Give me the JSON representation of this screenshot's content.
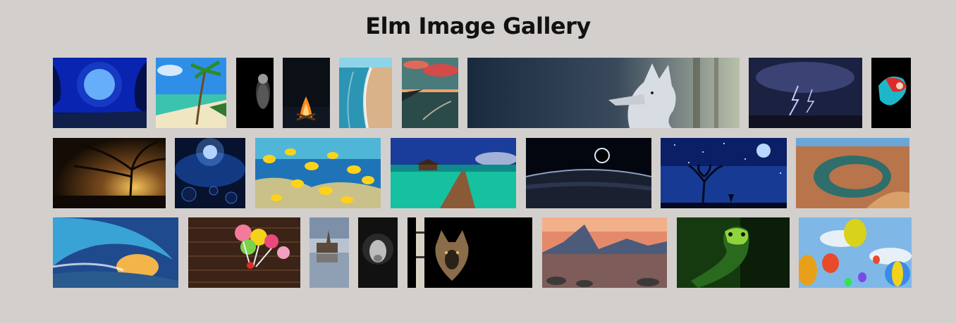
{
  "page": {
    "title": "Elm Image Gallery"
  },
  "gallery": {
    "rows": [
      {
        "images": [
          {
            "name": "moonlit-forest",
            "colors": [
              "#071a8a",
              "#0b2ed6",
              "#7fd0ff"
            ]
          },
          {
            "name": "tropical-beach",
            "colors": [
              "#2f8fe8",
              "#3cc3b0",
              "#f0e6c2"
            ]
          },
          {
            "name": "leopard-dark",
            "colors": [
              "#000000",
              "#1a1a1a",
              "#9a9a9a"
            ]
          },
          {
            "name": "campfire-night",
            "colors": [
              "#0b0f16",
              "#111722",
              "#ff8a22"
            ]
          },
          {
            "name": "shoreline-waves",
            "colors": [
              "#8fd3e8",
              "#2c95b4",
              "#d9b28a"
            ]
          },
          {
            "name": "sunset-shore",
            "colors": [
              "#2b4a4a",
              "#d24a4a",
              "#f3a26b"
            ]
          },
          {
            "name": "white-wolf-forest",
            "colors": [
              "#1a2a3e",
              "#3a4a5c",
              "#d8dde3"
            ]
          },
          {
            "name": "lightning-storm",
            "colors": [
              "#1b2140",
              "#3b4374",
              "#c9c9ff"
            ]
          },
          {
            "name": "colorful-ink",
            "colors": [
              "#000000",
              "#1db7c9",
              "#e02a2a"
            ]
          }
        ]
      },
      {
        "images": [
          {
            "name": "sunset-tree",
            "colors": [
              "#150d05",
              "#7a4b1e",
              "#f5c35a"
            ]
          },
          {
            "name": "cosmic-galaxy",
            "colors": [
              "#06122e",
              "#1a4aa8",
              "#d9ecff"
            ]
          },
          {
            "name": "yellow-fish-reef",
            "colors": [
              "#1f74b7",
              "#50b6d8",
              "#ffd21a"
            ]
          },
          {
            "name": "overwater-pier",
            "colors": [
              "#1a3c9a",
              "#16c1a0",
              "#8a5a36"
            ]
          },
          {
            "name": "solar-eclipse-earth",
            "colors": [
              "#03060f",
              "#1b2030",
              "#8aa0c0"
            ]
          },
          {
            "name": "starry-night-tree",
            "colors": [
              "#0b1f66",
              "#1f4fb3",
              "#b9d6ff"
            ]
          },
          {
            "name": "horseshoe-canyon",
            "colors": [
              "#6aa6d6",
              "#b8744a",
              "#2f6e6a"
            ]
          }
        ]
      },
      {
        "images": [
          {
            "name": "ocean-wave-tube",
            "colors": [
              "#1f4a8e",
              "#3aa3d6",
              "#f3b44a"
            ]
          },
          {
            "name": "lollipops-wood",
            "colors": [
              "#3b2417",
              "#5a3826",
              "#f27a9a"
            ]
          },
          {
            "name": "castle-reflection",
            "colors": [
              "#7d90a8",
              "#b9c3cf",
              "#5a4a3a"
            ]
          },
          {
            "name": "lion-monochrome",
            "colors": [
              "#111111",
              "#2a2a2a",
              "#bdbdbd"
            ]
          },
          {
            "name": "wolf-birch",
            "colors": [
              "#000000",
              "#2a2218",
              "#8a6c4a"
            ]
          },
          {
            "name": "mountain-lake",
            "colors": [
              "#e48a6a",
              "#4d5b7a",
              "#2a3a4a"
            ]
          },
          {
            "name": "green-snake",
            "colors": [
              "#163a10",
              "#2a6a1e",
              "#8fd43a"
            ]
          },
          {
            "name": "hot-air-balloons",
            "colors": [
              "#7fb8e6",
              "#e7f0f7",
              "#e84a2a"
            ]
          }
        ]
      }
    ]
  }
}
